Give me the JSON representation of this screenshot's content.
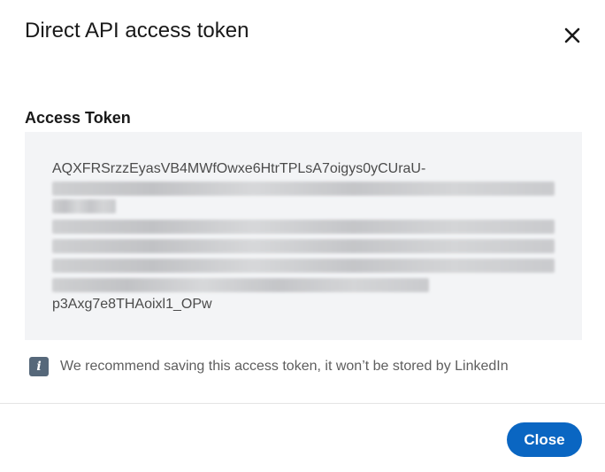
{
  "dialog": {
    "title": "Direct API access token",
    "close_icon": "close-icon"
  },
  "token": {
    "label": "Access Token",
    "first_line": "AQXFRSrzzEyasVB4MWfOwxe6HtrTPLsA7oigys0yCUraU-",
    "last_line": "p3Axg7e8THAoixl1_OPw"
  },
  "notice": {
    "icon": "info-icon",
    "icon_glyph": "i",
    "text": "We recommend saving this access token, it won’t be stored by LinkedIn"
  },
  "footer": {
    "close_label": "Close"
  },
  "colors": {
    "primary": "#0a66c2",
    "token_background": "#f3f4f6",
    "info_icon": "#56687a"
  }
}
